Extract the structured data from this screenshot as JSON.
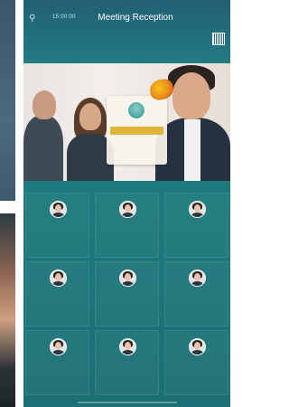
{
  "topbar": {
    "time": "15:00:00",
    "title": "Meeting Reception"
  },
  "colors": {
    "screen_teal": "#1d7a7c",
    "header_teal": "#215f74",
    "card_accent": "#e0b63a"
  },
  "icons": [
    "search-icon",
    "qr-code-icon",
    "avatar-icon"
  ]
}
